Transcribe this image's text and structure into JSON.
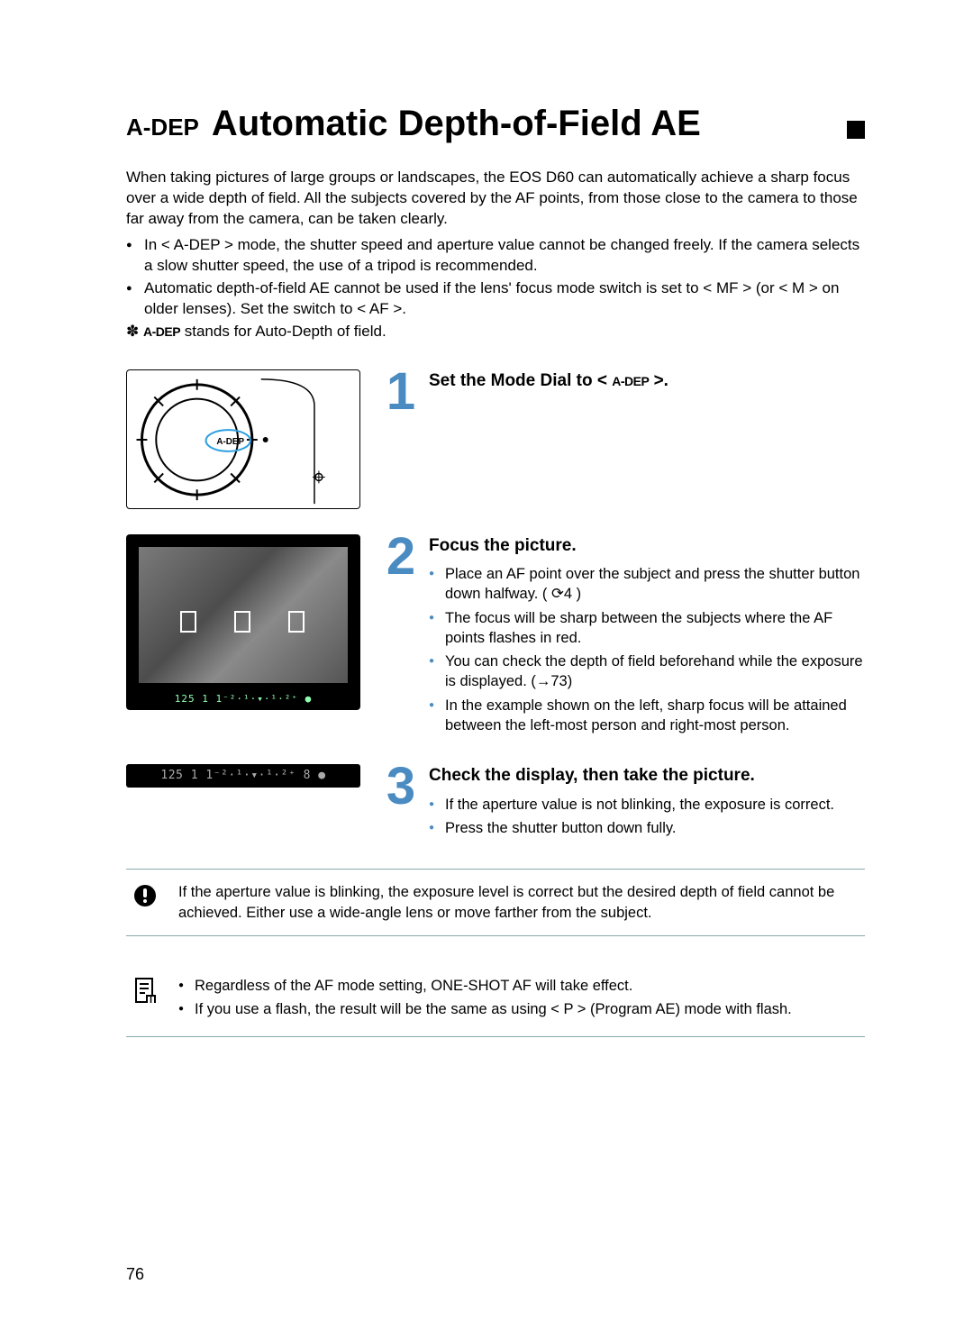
{
  "page": {
    "number": "76",
    "heading_prefix": "A-DEP",
    "heading": "Automatic Depth-of-Field AE"
  },
  "intro": {
    "paragraph": "When taking pictures of large groups or landscapes, the EOS D60 can automatically achieve a sharp focus over a wide depth of field. All the subjects covered by the AF points, from those close to the camera to those far away from the camera, can be taken clearly.",
    "bullets": [
      "In < A-DEP > mode, the shutter speed and aperture value cannot be changed freely. If the camera selects a slow shutter speed, the use of a tripod is recommended.",
      "Automatic depth-of-field AE cannot be used if the lens' focus mode switch is set to < MF > (or < M > on older lenses). Set the switch to < AF >."
    ],
    "star_note_prefix": "✽ ",
    "star_note_adep": "A-DEP",
    "star_note_suffix": " stands for Auto-Depth of field."
  },
  "steps": [
    {
      "number": "1",
      "title_prefix": "Set the Mode Dial to < ",
      "title_adep": "A-DEP",
      "title_suffix": " >.",
      "bullets": []
    },
    {
      "number": "2",
      "title": "Focus the picture.",
      "bullets": [
        "Place an AF point over the subject and press the shutter button down halfway. ( ⟳4 )",
        "The focus will be sharp between the subjects where the AF points flashes in red.",
        "You can check the depth of field beforehand while the exposure is displayed. (→73)",
        "In the example shown on the left, sharp focus will be attained between the left-most person and right-most person."
      ]
    },
    {
      "number": "3",
      "title": "Check the display, then take the picture.",
      "bullets": [
        "If the aperture value is not blinking, the exposure is correct.",
        "Press the shutter button down fully."
      ]
    }
  ],
  "lcd": {
    "viewfinder_readout": "125   1 1⁻²·¹·▾·¹·²⁺   ●",
    "panel_readout": "125   1 1⁻²·¹·▾·¹·²⁺ 8 ●"
  },
  "notes": {
    "warning": "If the aperture value is blinking, the exposure level is correct but the desired depth of field cannot be achieved. Either use a wide-angle lens or move farther from the subject.",
    "info_bullets": [
      "Regardless of the AF mode setting, ONE-SHOT AF will take effect.",
      "If you use a flash, the result will be the same as using < P > (Program AE) mode with flash."
    ]
  },
  "icons": {
    "warning": "❕",
    "note_page": "📄"
  }
}
